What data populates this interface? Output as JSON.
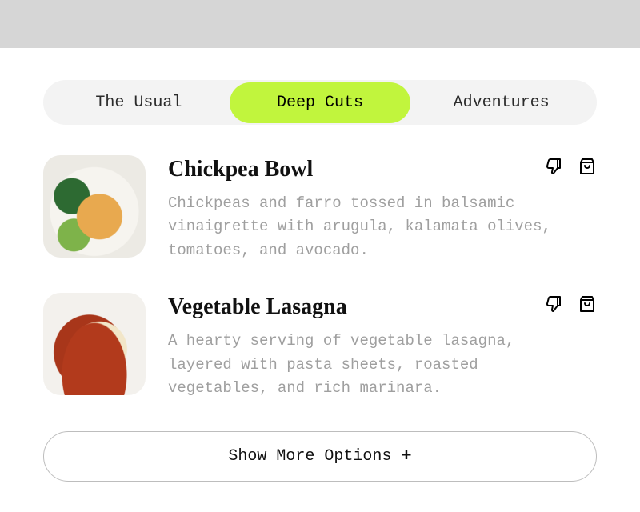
{
  "tabs": [
    {
      "label": "The Usual",
      "active": false
    },
    {
      "label": "Deep Cuts",
      "active": true
    },
    {
      "label": "Adventures",
      "active": false
    }
  ],
  "items": [
    {
      "title": "Chickpea Bowl",
      "description": "Chickpeas and farro tossed in balsamic vinaigrette with arugula, kalamata olives, tomatoes, and avocado."
    },
    {
      "title": "Vegetable Lasagna",
      "description": "A hearty serving of vegetable lasagna, layered with pasta sheets, roasted vegetables, and rich marinara."
    }
  ],
  "show_more_label": "Show More Options",
  "colors": {
    "accent": "#c1f53d",
    "tab_bg": "#f3f3f3",
    "muted_text": "#9f9f9f"
  }
}
